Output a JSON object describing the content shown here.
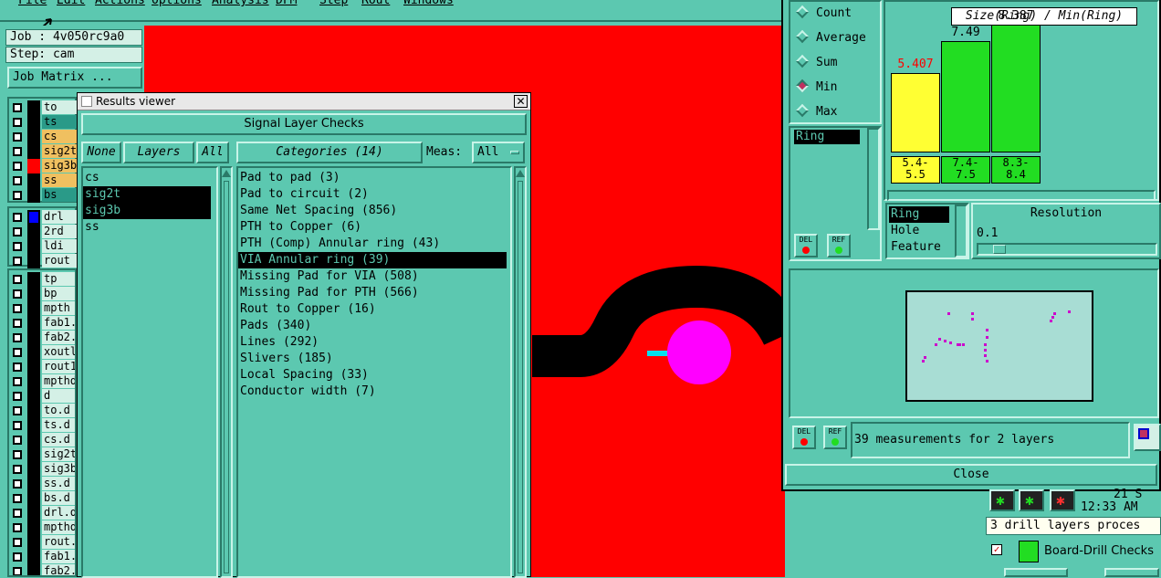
{
  "menubar": [
    "File",
    "Edit",
    "Actions",
    "Options",
    "Analysis",
    "DFM",
    "Step",
    "Rout",
    "Windows"
  ],
  "left": {
    "job": "Job : 4v050rc9a0",
    "step": "Step: cam",
    "job_matrix": "Job Matrix ...",
    "layers_a": [
      {
        "name": "to",
        "color": "#d4f0e6",
        "sw": "#000000"
      },
      {
        "name": "ts",
        "color": "#2a9a88",
        "sw": "#000000"
      },
      {
        "name": "cs",
        "color": "#f0c060",
        "sw": "#000000"
      },
      {
        "name": "sig2t",
        "color": "#f0c060",
        "sw": "#000000"
      },
      {
        "name": "sig3b",
        "color": "#f0c060",
        "sw": "#ff0000"
      },
      {
        "name": "ss",
        "color": "#f0c060",
        "sw": "#000000"
      },
      {
        "name": "bs",
        "color": "#2a9a88",
        "sw": "#000000"
      }
    ],
    "layers_b": [
      {
        "name": "drl",
        "color": "#d4f0e6",
        "sw": "#0000ff"
      },
      {
        "name": "2rd",
        "color": "#d4f0e6",
        "sw": "#000000"
      },
      {
        "name": "ldi",
        "color": "#d4f0e6",
        "sw": "#000000"
      },
      {
        "name": "rout",
        "color": "#d4f0e6",
        "sw": "#000000"
      }
    ],
    "layers_c": [
      "tp",
      "bp",
      "mpth",
      "fab1.",
      "fab2.",
      "xoutl",
      "rout1",
      "mpthd",
      "d",
      "to.d",
      "ts.d",
      "cs.d",
      "sig2t",
      "sig3b",
      "ss.d",
      "bs.d",
      "drl.d",
      "mpthd",
      "rout.",
      "fab1.",
      "fab2."
    ]
  },
  "results_viewer": {
    "window_title": "Results viewer",
    "header": "Signal Layer Checks",
    "none_btn": "None",
    "layers_label": "Layers",
    "all_btn": "All",
    "categories_label": "Categories (14)",
    "meas_label": "Meas:",
    "meas_value": "All",
    "layers": [
      {
        "name": "cs",
        "selected": false
      },
      {
        "name": "sig2t",
        "selected": true
      },
      {
        "name": "sig3b",
        "selected": true
      },
      {
        "name": "ss",
        "selected": false
      }
    ],
    "categories": [
      {
        "label": "Pad to pad (3)",
        "selected": false
      },
      {
        "label": "Pad to circuit (2)",
        "selected": false
      },
      {
        "label": "Same Net Spacing (856)",
        "selected": false
      },
      {
        "label": "PTH to Copper (6)",
        "selected": false
      },
      {
        "label": "PTH (Comp) Annular ring (43)",
        "selected": false
      },
      {
        "label": "VIA Annular ring (39)",
        "selected": true
      },
      {
        "label": "Missing Pad for VIA (508)",
        "selected": false
      },
      {
        "label": "Missing Pad for PTH (566)",
        "selected": false
      },
      {
        "label": "Rout to Copper (16)",
        "selected": false
      },
      {
        "label": "Pads (340)",
        "selected": false
      },
      {
        "label": "Lines (292)",
        "selected": false
      },
      {
        "label": "Slivers (185)",
        "selected": false
      },
      {
        "label": "Local Spacing (33)",
        "selected": false
      },
      {
        "label": "Conductor width (7)",
        "selected": false
      }
    ]
  },
  "stats": {
    "options": [
      {
        "label": "Count",
        "selected": false
      },
      {
        "label": "Average",
        "selected": false
      },
      {
        "label": "Sum",
        "selected": false
      },
      {
        "label": "Min",
        "selected": true
      },
      {
        "label": "Max",
        "selected": false
      }
    ],
    "field_value": "Ring",
    "del": "DEL",
    "ref": "REF"
  },
  "histogram": {
    "title": "Size(Ring) / Min(Ring)",
    "bars": [
      {
        "value": "5.407",
        "range": "5.4-\n5.5",
        "height": 0.58,
        "color": "#ffff33",
        "valuecolor": "#ff0000"
      },
      {
        "value": "7.49",
        "range": "7.4-\n7.5",
        "height": 0.81,
        "color": "#22dd22",
        "valuecolor": "#000000"
      },
      {
        "value": "8.387",
        "range": "8.3-\n8.4",
        "height": 0.93,
        "color": "#22dd22",
        "valuecolor": "#000000"
      }
    ],
    "ranges": [
      "5.4-\n5.5",
      "7.4-\n7.5",
      "8.3-\n8.4"
    ],
    "field_list": [
      {
        "label": "Ring",
        "selected": true
      },
      {
        "label": "Hole",
        "selected": false
      },
      {
        "label": "Feature",
        "selected": false
      }
    ],
    "resolution_label": "Resolution",
    "resolution_value": "0.1"
  },
  "bottom": {
    "status": "39 measurements for 2 layers",
    "close": "Close"
  },
  "extra": {
    "date": "21 S",
    "time": "12:33 AM",
    "process_msg": "3 drill layers proces",
    "board_drill": "Board-Drill Checks"
  },
  "colors": {
    "panel": "#5cc8b0",
    "canvas": "#ff0000",
    "highlight": "#ff00ff"
  }
}
